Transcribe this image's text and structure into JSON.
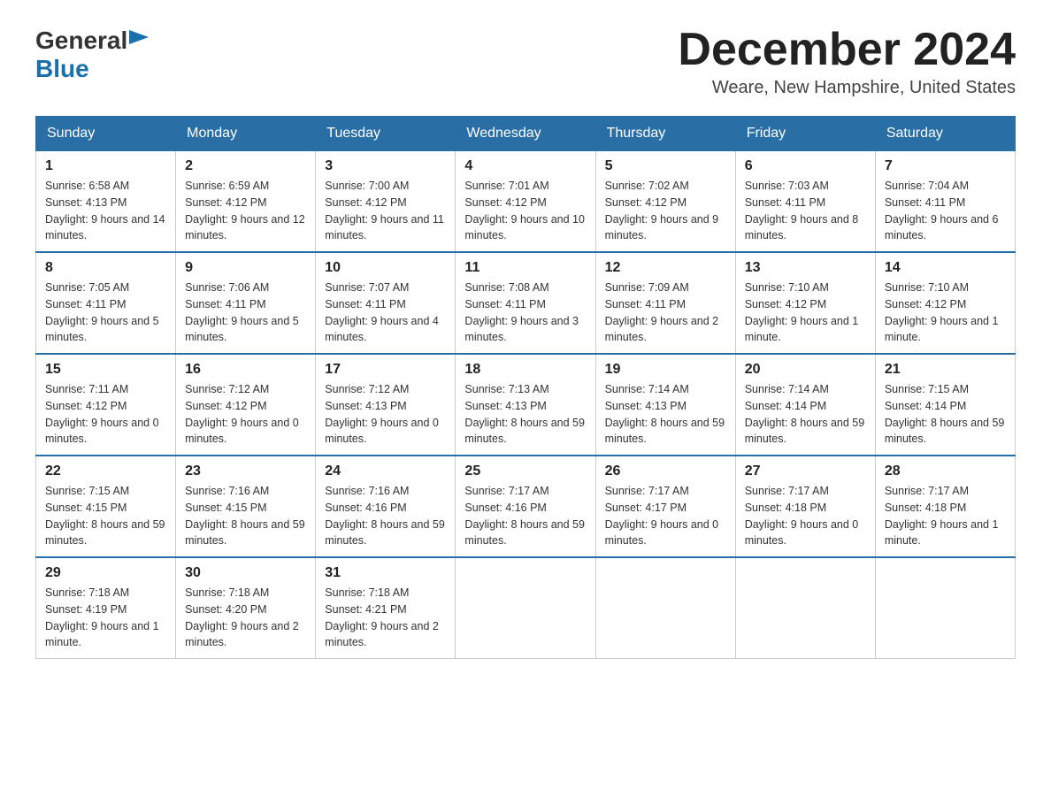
{
  "header": {
    "logo_general": "General",
    "logo_blue": "Blue",
    "month_title": "December 2024",
    "location": "Weare, New Hampshire, United States"
  },
  "days_of_week": [
    "Sunday",
    "Monday",
    "Tuesday",
    "Wednesday",
    "Thursday",
    "Friday",
    "Saturday"
  ],
  "weeks": [
    [
      {
        "day": "1",
        "sunrise": "6:58 AM",
        "sunset": "4:13 PM",
        "daylight": "9 hours and 14 minutes."
      },
      {
        "day": "2",
        "sunrise": "6:59 AM",
        "sunset": "4:12 PM",
        "daylight": "9 hours and 12 minutes."
      },
      {
        "day": "3",
        "sunrise": "7:00 AM",
        "sunset": "4:12 PM",
        "daylight": "9 hours and 11 minutes."
      },
      {
        "day": "4",
        "sunrise": "7:01 AM",
        "sunset": "4:12 PM",
        "daylight": "9 hours and 10 minutes."
      },
      {
        "day": "5",
        "sunrise": "7:02 AM",
        "sunset": "4:12 PM",
        "daylight": "9 hours and 9 minutes."
      },
      {
        "day": "6",
        "sunrise": "7:03 AM",
        "sunset": "4:11 PM",
        "daylight": "9 hours and 8 minutes."
      },
      {
        "day": "7",
        "sunrise": "7:04 AM",
        "sunset": "4:11 PM",
        "daylight": "9 hours and 6 minutes."
      }
    ],
    [
      {
        "day": "8",
        "sunrise": "7:05 AM",
        "sunset": "4:11 PM",
        "daylight": "9 hours and 5 minutes."
      },
      {
        "day": "9",
        "sunrise": "7:06 AM",
        "sunset": "4:11 PM",
        "daylight": "9 hours and 5 minutes."
      },
      {
        "day": "10",
        "sunrise": "7:07 AM",
        "sunset": "4:11 PM",
        "daylight": "9 hours and 4 minutes."
      },
      {
        "day": "11",
        "sunrise": "7:08 AM",
        "sunset": "4:11 PM",
        "daylight": "9 hours and 3 minutes."
      },
      {
        "day": "12",
        "sunrise": "7:09 AM",
        "sunset": "4:11 PM",
        "daylight": "9 hours and 2 minutes."
      },
      {
        "day": "13",
        "sunrise": "7:10 AM",
        "sunset": "4:12 PM",
        "daylight": "9 hours and 1 minute."
      },
      {
        "day": "14",
        "sunrise": "7:10 AM",
        "sunset": "4:12 PM",
        "daylight": "9 hours and 1 minute."
      }
    ],
    [
      {
        "day": "15",
        "sunrise": "7:11 AM",
        "sunset": "4:12 PM",
        "daylight": "9 hours and 0 minutes."
      },
      {
        "day": "16",
        "sunrise": "7:12 AM",
        "sunset": "4:12 PM",
        "daylight": "9 hours and 0 minutes."
      },
      {
        "day": "17",
        "sunrise": "7:12 AM",
        "sunset": "4:13 PM",
        "daylight": "9 hours and 0 minutes."
      },
      {
        "day": "18",
        "sunrise": "7:13 AM",
        "sunset": "4:13 PM",
        "daylight": "8 hours and 59 minutes."
      },
      {
        "day": "19",
        "sunrise": "7:14 AM",
        "sunset": "4:13 PM",
        "daylight": "8 hours and 59 minutes."
      },
      {
        "day": "20",
        "sunrise": "7:14 AM",
        "sunset": "4:14 PM",
        "daylight": "8 hours and 59 minutes."
      },
      {
        "day": "21",
        "sunrise": "7:15 AM",
        "sunset": "4:14 PM",
        "daylight": "8 hours and 59 minutes."
      }
    ],
    [
      {
        "day": "22",
        "sunrise": "7:15 AM",
        "sunset": "4:15 PM",
        "daylight": "8 hours and 59 minutes."
      },
      {
        "day": "23",
        "sunrise": "7:16 AM",
        "sunset": "4:15 PM",
        "daylight": "8 hours and 59 minutes."
      },
      {
        "day": "24",
        "sunrise": "7:16 AM",
        "sunset": "4:16 PM",
        "daylight": "8 hours and 59 minutes."
      },
      {
        "day": "25",
        "sunrise": "7:17 AM",
        "sunset": "4:16 PM",
        "daylight": "8 hours and 59 minutes."
      },
      {
        "day": "26",
        "sunrise": "7:17 AM",
        "sunset": "4:17 PM",
        "daylight": "9 hours and 0 minutes."
      },
      {
        "day": "27",
        "sunrise": "7:17 AM",
        "sunset": "4:18 PM",
        "daylight": "9 hours and 0 minutes."
      },
      {
        "day": "28",
        "sunrise": "7:17 AM",
        "sunset": "4:18 PM",
        "daylight": "9 hours and 1 minute."
      }
    ],
    [
      {
        "day": "29",
        "sunrise": "7:18 AM",
        "sunset": "4:19 PM",
        "daylight": "9 hours and 1 minute."
      },
      {
        "day": "30",
        "sunrise": "7:18 AM",
        "sunset": "4:20 PM",
        "daylight": "9 hours and 2 minutes."
      },
      {
        "day": "31",
        "sunrise": "7:18 AM",
        "sunset": "4:21 PM",
        "daylight": "9 hours and 2 minutes."
      },
      null,
      null,
      null,
      null
    ]
  ],
  "labels": {
    "sunrise": "Sunrise:",
    "sunset": "Sunset:",
    "daylight": "Daylight:"
  }
}
